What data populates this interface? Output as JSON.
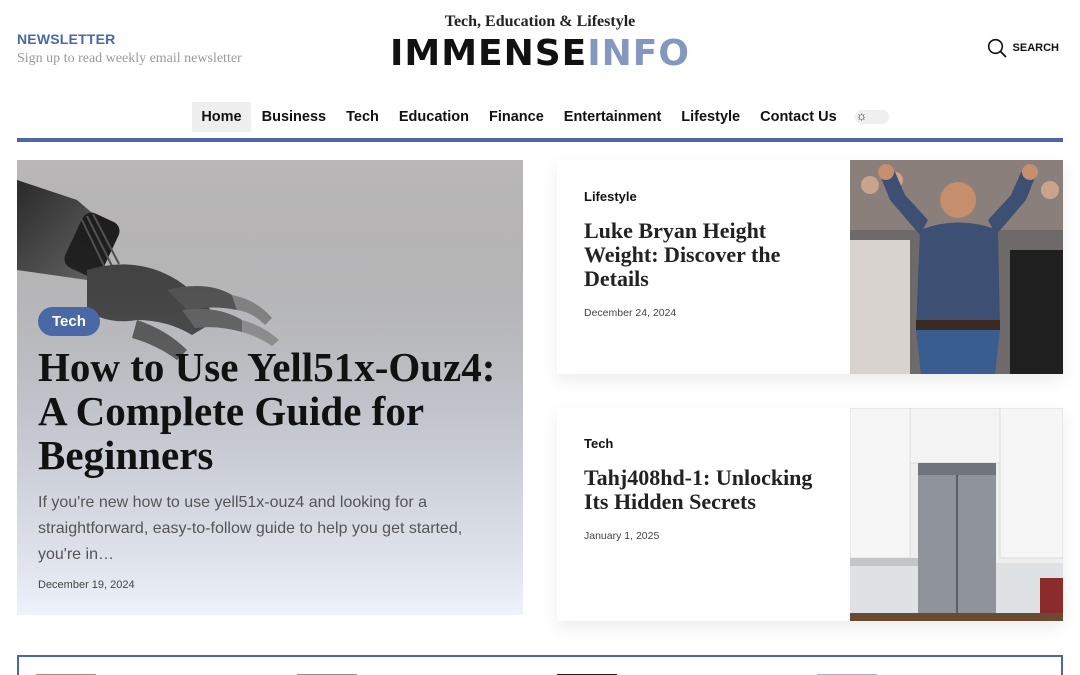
{
  "header": {
    "newsletter_title": "NEWSLETTER",
    "newsletter_sub": "Sign up to read weekly email newsletter",
    "tagline": "Tech, Education & Lifestyle",
    "logo_part1": "IMMENSE",
    "logo_part2": "INFO",
    "search_label": "SEARCH"
  },
  "nav": {
    "items": [
      "Home",
      "Business",
      "Tech",
      "Education",
      "Finance",
      "Entertainment",
      "Lifestyle",
      "Contact Us"
    ],
    "active": "Home",
    "theme_toggle_icon": "sun-icon"
  },
  "hero": {
    "category": "Tech",
    "title": "How to Use Yell51x-Ouz4: A Complete Guide for Beginners",
    "excerpt": "If you're new how to use yell51x-ouz4 and looking for a straightforward, easy-to-follow guide to help you get started, you're in…",
    "date": "December 19, 2024"
  },
  "cards": [
    {
      "category": "Lifestyle",
      "title": "Luke Bryan Height Weight: Discover the Details",
      "date": "December 24, 2024"
    },
    {
      "category": "Tech",
      "title": "Tahj408hd-1: Unlocking Its Hidden Secrets",
      "date": "January 1, 2025"
    }
  ],
  "colors": {
    "accent": "#4a68a5",
    "logo_secondary": "#8497bf"
  }
}
